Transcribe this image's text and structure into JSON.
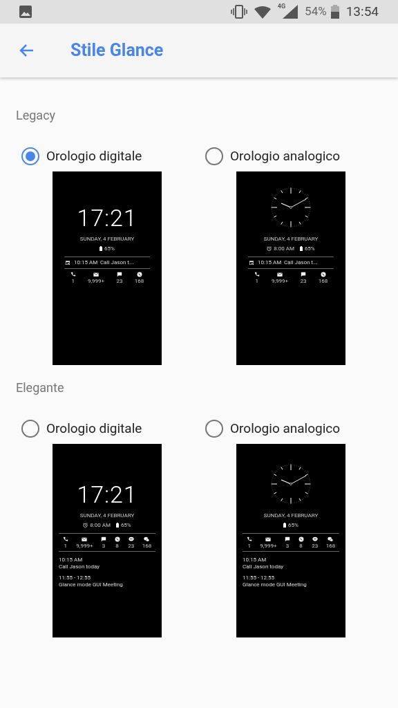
{
  "status_bar": {
    "network": "4G",
    "battery": "54%",
    "time": "13:54"
  },
  "app_bar": {
    "title": "Stile Glance"
  },
  "sections": [
    {
      "title": "Legacy",
      "options": [
        {
          "label": "Orologio digitale",
          "selected": true,
          "preview": {
            "kind": "digital",
            "time": "17:21",
            "date": "SUNDAY, 4 FEBRUARY",
            "battery": "65%",
            "event": {
              "time": "10:15 AM",
              "text": "Call Jason t..."
            },
            "notifications": [
              {
                "kind": "phone",
                "count": "1"
              },
              {
                "kind": "mail",
                "count": "9,999+"
              },
              {
                "kind": "message",
                "count": "23"
              },
              {
                "kind": "whatsapp",
                "count": "168"
              }
            ]
          }
        },
        {
          "label": "Orologio analogico",
          "selected": false,
          "preview": {
            "kind": "analog",
            "date": "SUNDAY, 4 FEBRUARY",
            "alarm": "8:00 AM",
            "battery": "65%",
            "event": {
              "time": "10:15 AM",
              "text": "Call Jason t..."
            },
            "notifications": [
              {
                "kind": "phone",
                "count": "1"
              },
              {
                "kind": "mail",
                "count": "9,999+"
              },
              {
                "kind": "message",
                "count": "23"
              },
              {
                "kind": "whatsapp",
                "count": "168"
              }
            ]
          }
        }
      ]
    },
    {
      "title": "Elegante",
      "options": [
        {
          "label": "Orologio digitale",
          "selected": false,
          "preview": {
            "kind": "digital",
            "time": "17:21",
            "date": "SUNDAY, 4 FEBRUARY",
            "alarm": "8:00 AM",
            "battery": "65%",
            "notifications": [
              {
                "kind": "phone",
                "count": "1"
              },
              {
                "kind": "mail",
                "count": "9,999+"
              },
              {
                "kind": "message",
                "count": "3"
              },
              {
                "kind": "whatsapp",
                "count": "8"
              },
              {
                "kind": "chat",
                "count": "23"
              },
              {
                "kind": "wechat",
                "count": "168"
              }
            ],
            "events": [
              {
                "time": "10:15 AM",
                "text": "Call Jason today"
              },
              {
                "time": "11:55 - 12:55",
                "text": "Glance mode GUI Meeting"
              }
            ]
          }
        },
        {
          "label": "Orologio analogico",
          "selected": false,
          "preview": {
            "kind": "analog",
            "date": "SUNDAY, 4 FEBRUARY",
            "battery": "65%",
            "notifications": [
              {
                "kind": "phone",
                "count": "1"
              },
              {
                "kind": "mail",
                "count": "9,999+"
              },
              {
                "kind": "message",
                "count": "3"
              },
              {
                "kind": "whatsapp",
                "count": "8"
              },
              {
                "kind": "chat",
                "count": "23"
              },
              {
                "kind": "wechat",
                "count": "168"
              }
            ],
            "events": [
              {
                "time": "10:15 AM",
                "text": "Call Jason today"
              },
              {
                "time": "11:55 - 12:55",
                "text": "Glance mode GUI Meeting"
              }
            ]
          }
        }
      ]
    }
  ]
}
